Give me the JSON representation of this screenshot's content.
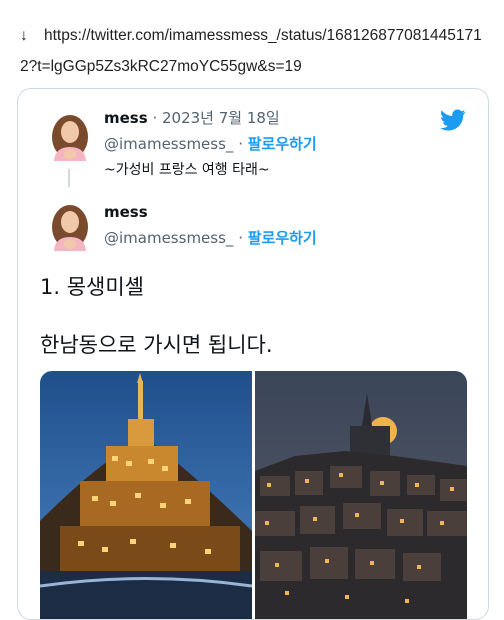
{
  "share_link": {
    "arrow": "↓",
    "url": "https://twitter.com/imamessmess_/status/1681268770814451712?t=lgGGp5Zs3kRC27moYC55gw&s=19"
  },
  "tweet_parent": {
    "name": "mess",
    "separator": " · ",
    "date": "2023년 7월 18일",
    "handle": "@imamessmess_",
    "dot": " · ",
    "follow": "팔로우하기",
    "text": "~가성비 프랑스 여행 타래~"
  },
  "tweet_reply": {
    "name": "mess",
    "handle": "@imamessmess_",
    "dot": " · ",
    "follow": "팔로우하기",
    "line1": "1. 몽생미셸",
    "line2": "한남동으로 가시면 됩니다."
  },
  "icons": {
    "brand": "twitter-bird-icon",
    "arrow": "down-arrow-icon",
    "brand_color": "#1d9bf0"
  }
}
